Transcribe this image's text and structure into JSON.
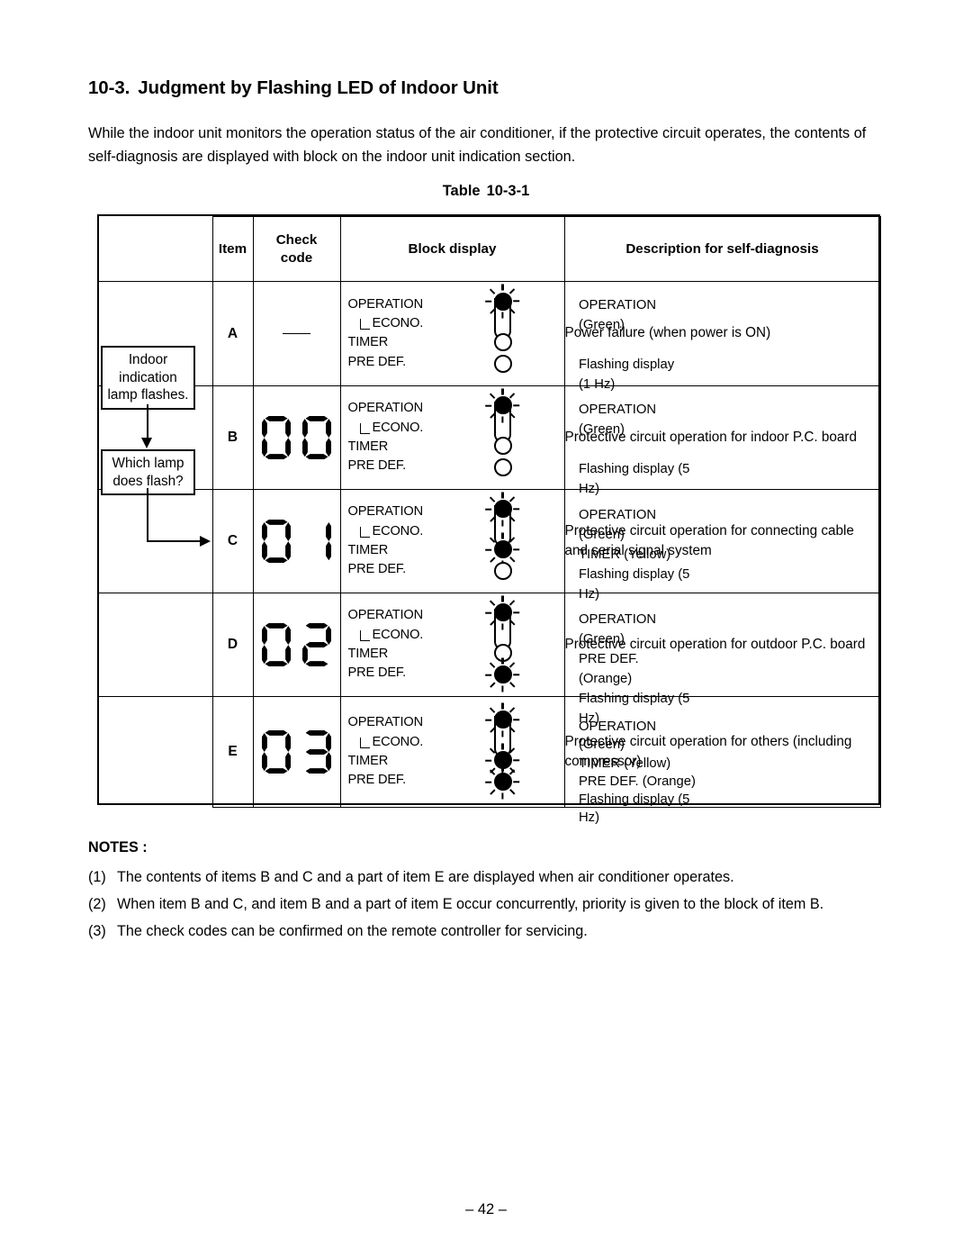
{
  "heading": {
    "number": "10-3.",
    "title": "Judgment by Flashing LED of Indoor Unit"
  },
  "intro": "While the indoor unit monitors the operation status of the air conditioner, if the protective circuit operates, the contents of self-diagnosis are displayed with block on the indoor unit indication section.",
  "table_caption": {
    "label": "Table",
    "number": "10-3-1"
  },
  "table": {
    "headers": {
      "item": "Item",
      "check_code_line1": "Check",
      "check_code_line2": "code",
      "block_display": "Block display",
      "description": "Description for self-diagnosis"
    },
    "lamp_labels": {
      "operation": "OPERATION",
      "econo": "ECONO.",
      "timer": "TIMER",
      "pre_def": "PRE DEF."
    },
    "rows": [
      {
        "item": "A",
        "check_code": "—",
        "lamps": {
          "operation": "flashing",
          "timer": "off",
          "pre_def": "off"
        },
        "status_lines": [
          "OPERATION (Green)",
          "",
          "Flashing display (1 Hz)"
        ],
        "description": "Power failure (when power is ON)"
      },
      {
        "item": "B",
        "check_code": "00",
        "lamps": {
          "operation": "flashing",
          "timer": "off",
          "pre_def": "off"
        },
        "status_lines": [
          "OPERATION (Green)",
          "",
          "Flashing display (5 Hz)"
        ],
        "description": "Protective circuit operation for indoor P.C. board"
      },
      {
        "item": "C",
        "check_code": "01",
        "lamps": {
          "operation": "flashing",
          "timer": "flashing",
          "pre_def": "off"
        },
        "status_lines": [
          "OPERATION (Green)",
          "TIMER (Yellow)",
          "Flashing display (5 Hz)"
        ],
        "description": "Protective circuit operation for connecting cable and serial signal system"
      },
      {
        "item": "D",
        "check_code": "02",
        "lamps": {
          "operation": "flashing",
          "timer": "off",
          "pre_def": "flashing"
        },
        "status_lines": [
          "OPERATION (Green)",
          "PRE DEF. (Orange)",
          "Flashing display (5 Hz)"
        ],
        "description": "Protective circuit operation for outdoor P.C. board"
      },
      {
        "item": "E",
        "check_code": "03",
        "lamps": {
          "operation": "flashing",
          "timer": "flashing",
          "pre_def": "flashing"
        },
        "status_lines": [
          "OPERATION (Green)",
          "TIMER (Yellow)",
          "PRE DEF.  (Orange)",
          "Flashing display (5 Hz)"
        ],
        "description": "Protective circuit operation for others (including compressor)"
      }
    ]
  },
  "flowchart": {
    "box1": "Indoor\nindication\nlamp flashes.",
    "box2": "Which lamp\ndoes flash?"
  },
  "notes": {
    "title": "NOTES :",
    "items": [
      {
        "number": "(1)",
        "text": "The contents of items B and C and a part of item E are displayed when air conditioner operates."
      },
      {
        "number": "(2)",
        "text": "When item B and C, and item B and a part of item E occur concurrently, priority is given to the block of item B."
      },
      {
        "number": "(3)",
        "text": "The check codes can be confirmed on the remote controller for servicing."
      }
    ]
  },
  "footer": "– 42 –"
}
